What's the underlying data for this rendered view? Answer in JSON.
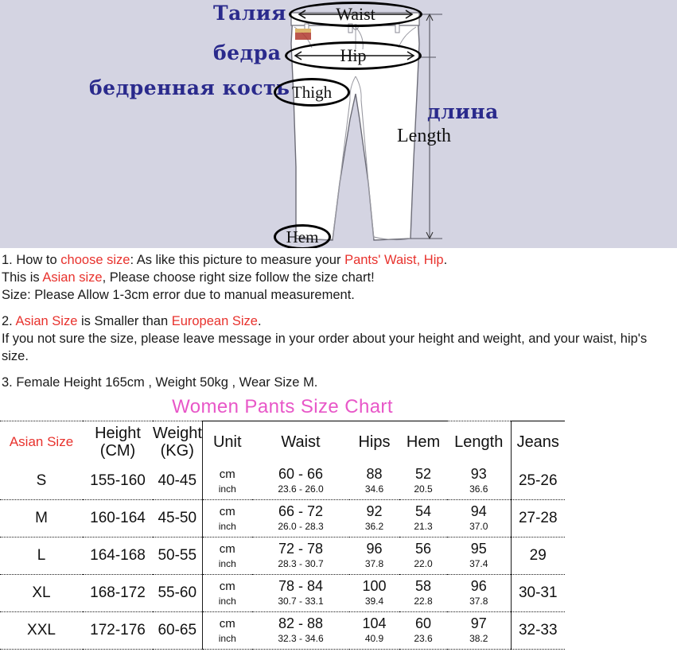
{
  "diagram": {
    "ru_waist": "Талия",
    "ru_hip": "бедра",
    "ru_thigh": "бедренная кость",
    "ru_length": "длина",
    "en_length": "Length",
    "callout_waist": "Waist",
    "callout_hip": "Hip",
    "callout_thigh": "Thigh",
    "callout_hem": "Hem",
    "background_color": "#d4d4e2",
    "ru_text_color": "#2a2a8c"
  },
  "notes": {
    "n1_a": "1. How to ",
    "n1_b": "choose size",
    "n1_c": ": As like this picture to measure your ",
    "n1_d": "Pants' Waist, Hip",
    "n1_e": ".",
    "n2_a": "This is ",
    "n2_b": "Asian size",
    "n2_c": ", Please choose right size follow the size chart!",
    "n3": "Size: Please Allow 1-3cm error due to manual measurement.",
    "n4_a": "2. ",
    "n4_b": "Asian Size",
    "n4_c": " is Smaller than ",
    "n4_d": "European Size",
    "n4_e": ".",
    "n5": "If you not sure the size, please leave message in your order about your height and weight, and your waist, hip's size.",
    "n6": "3. Female Height 165cm , Weight 50kg , Wear Size M.",
    "highlight_color": "#e8322d"
  },
  "table": {
    "title": "Women Pants  Size   Chart",
    "title_color": "#e857c8",
    "headers": {
      "size": "Asian Size",
      "height": "Height",
      "height_unit": "(CM)",
      "weight": "Weight",
      "weight_unit": "(KG)",
      "unit": "Unit",
      "waist": "Waist",
      "hips": "Hips",
      "hem": "Hem",
      "length": "Length",
      "jeans": "Jeans"
    },
    "unit_labels": {
      "cm": "cm",
      "inch": "inch"
    },
    "rows": [
      {
        "size": "S",
        "height": "155-160",
        "weight": "40-45",
        "waist_cm": "60 - 66",
        "waist_inch": "23.6 -  26.0",
        "hips_cm": "88",
        "hips_inch": "34.6",
        "hem_cm": "52",
        "hem_inch": "20.5",
        "length_cm": "93",
        "length_inch": "36.6",
        "jeans": "25-26"
      },
      {
        "size": "M",
        "height": "160-164",
        "weight": "45-50",
        "waist_cm": "66 - 72",
        "waist_inch": "26.0 -  28.3",
        "hips_cm": "92",
        "hips_inch": "36.2",
        "hem_cm": "54",
        "hem_inch": "21.3",
        "length_cm": "94",
        "length_inch": "37.0",
        "jeans": "27-28"
      },
      {
        "size": "L",
        "height": "164-168",
        "weight": "50-55",
        "waist_cm": "72 - 78",
        "waist_inch": "28.3 -  30.7",
        "hips_cm": "96",
        "hips_inch": "37.8",
        "hem_cm": "56",
        "hem_inch": "22.0",
        "length_cm": "95",
        "length_inch": "37.4",
        "jeans": "29"
      },
      {
        "size": "XL",
        "height": "168-172",
        "weight": "55-60",
        "waist_cm": "78 - 84",
        "waist_inch": "30.7 -  33.1",
        "hips_cm": "100",
        "hips_inch": "39.4",
        "hem_cm": "58",
        "hem_inch": "22.8",
        "length_cm": "96",
        "length_inch": "37.8",
        "jeans": "30-31"
      },
      {
        "size": "XXL",
        "height": "172-176",
        "weight": "60-65",
        "waist_cm": "82 - 88",
        "waist_inch": "32.3 -  34.6",
        "hips_cm": "104",
        "hips_inch": "40.9",
        "hem_cm": "60",
        "hem_inch": "23.6",
        "length_cm": "97",
        "length_inch": "38.2",
        "jeans": "32-33"
      }
    ]
  }
}
